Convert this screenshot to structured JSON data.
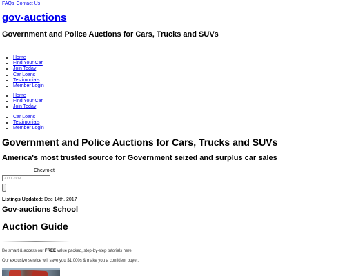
{
  "top_nav": {
    "faqs": "FAQs",
    "contact": "Contact Us"
  },
  "site": {
    "logo": "gov-auctions",
    "tagline": "Government and Police Auctions for Cars, Trucks and SUVs"
  },
  "nav_primary": [
    "Home",
    "Find Your Car",
    "Join Today",
    "Car Loans",
    "Testimonials",
    "Member Login"
  ],
  "nav_secondary_a": [
    "Home",
    "Find Your Car",
    "Join Today"
  ],
  "nav_secondary_b": [
    "Car Loans",
    "Testimonials",
    "Member Login"
  ],
  "main": {
    "heading": "Government and Police Auctions for Cars, Trucks and SUVs",
    "subheading": "America's most trusted source for Government seized and surplus car sales"
  },
  "search": {
    "make_value": "Chevrolet",
    "zip_placeholder": "Zip Code",
    "zip_value": ""
  },
  "listings": {
    "label": "Listings Updated:",
    "date": "Dec 14th, 2017"
  },
  "school": {
    "title": "Gov-auctions School"
  },
  "guide": {
    "title": "Auction Guide",
    "p1_pre": "Be smart & access our ",
    "p1_bold": "FREE",
    "p1_post": " value packed, step-by-step tutorials here.",
    "p2": "Our exclusive service will save you $1,000s & make you a confident buyer."
  }
}
